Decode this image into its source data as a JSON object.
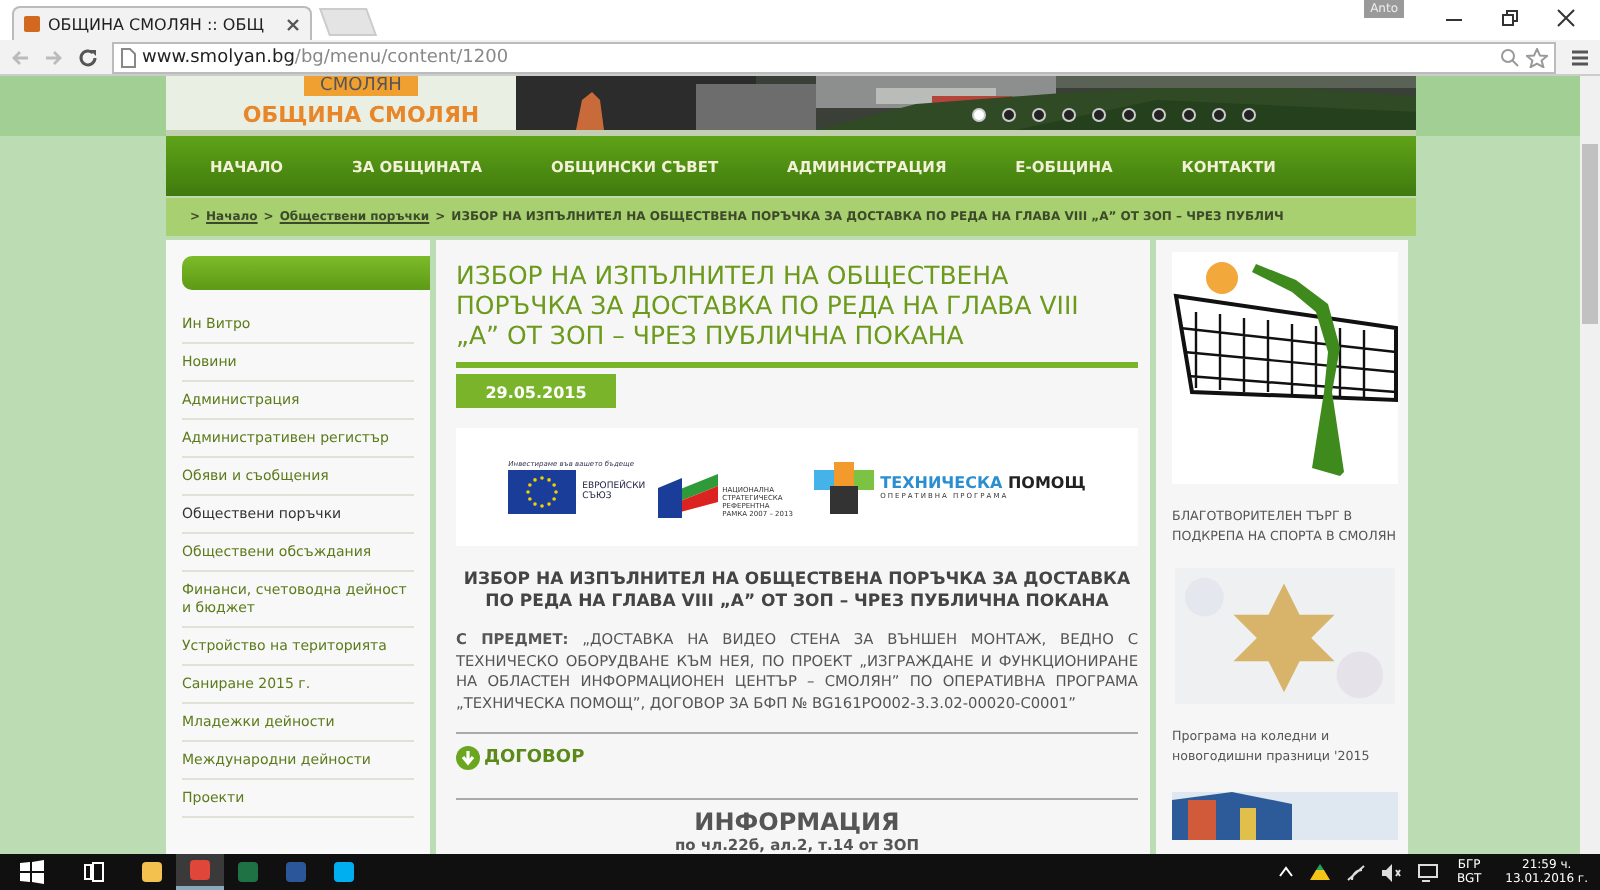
{
  "browser": {
    "tab_title": "ОБЩИНА СМОЛЯН :: ОБЩ",
    "user": "Anto",
    "url_host": "www.smolyan.bg",
    "url_path": "/bg/menu/content/1200"
  },
  "header": {
    "logo_badge": "СМОЛЯН",
    "logo_title": "ОБЩИНА СМОЛЯН",
    "slides": [
      {
        "selected": true
      },
      {
        "selected": false
      },
      {
        "selected": false
      },
      {
        "selected": false
      },
      {
        "selected": false
      },
      {
        "selected": false
      },
      {
        "selected": false
      },
      {
        "selected": false
      },
      {
        "selected": false
      },
      {
        "selected": false
      }
    ]
  },
  "nav": [
    "НАЧАЛО",
    "ЗА ОБЩИНАТА",
    "ОБЩИНСКИ СЪВЕТ",
    "АДМИНИСТРАЦИЯ",
    "Е-ОБЩИНА",
    "КОНТАКТИ"
  ],
  "breadcrumb": {
    "separator": ">",
    "links": [
      "Начало",
      "Обществени поръчки"
    ],
    "current": "ИЗБОР НА ИЗПЪЛНИТЕЛ НА ОБЩЕСТВЕНА ПОРЪЧКА ЗА ДОСТАВКА ПО РЕДА НА ГЛАВА VIII „А” ОТ ЗОП – ЧРЕЗ ПУБЛИЧ"
  },
  "sidebar": {
    "items": [
      {
        "label": "Ин Витро",
        "selected": false
      },
      {
        "label": "Новини",
        "selected": false
      },
      {
        "label": "Администрация",
        "selected": false
      },
      {
        "label": "Административен регистър",
        "selected": false
      },
      {
        "label": "Обяви и съобщения",
        "selected": false
      },
      {
        "label": "Обществени поръчки",
        "selected": true
      },
      {
        "label": "Обществени обсъждания",
        "selected": false
      },
      {
        "label": "Финанси, счетоводна дейност и бюджет",
        "selected": false
      },
      {
        "label": "Устройство на територията",
        "selected": false
      },
      {
        "label": "Саниране 2015 г.",
        "selected": false
      },
      {
        "label": "Младежки дейности",
        "selected": false
      },
      {
        "label": "Международни дейности",
        "selected": false
      },
      {
        "label": "Проекти",
        "selected": false
      }
    ]
  },
  "article": {
    "title": "ИЗБОР НА ИЗПЪЛНИТЕЛ НА ОБЩЕСТВЕНА ПОРЪЧКА ЗА ДОСТАВКА ПО РЕДА НА ГЛАВА VIII „А” ОТ ЗОП – ЧРЕЗ ПУБЛИЧНА ПОКАНА",
    "date": "29.05.2015",
    "logos": {
      "eu_caption": "Инвестираме във вашето бъдеще",
      "eu_name": "ЕВРОПЕЙСКИ СЪЮЗ",
      "nsrf": "НАЦИОНАЛНА СТРАТЕГИЧЕСКА РЕФЕРЕНТНА РАМКА 2007 – 2013",
      "ta_name_1": "ТЕХНИЧЕСКА",
      "ta_name_2": "ПОМОЩ",
      "ta_sub": "ОПЕРАТИВНА ПРОГРАМА"
    },
    "heading": "ИЗБОР НА ИЗПЪЛНИТЕЛ НА ОБЩЕСТВЕНА ПОРЪЧКА ЗА ДОСТАВКА ПО РЕДА НА ГЛАВА VIII „А” ОТ ЗОП – ЧРЕЗ ПУБЛИЧНА ПОКАНА",
    "subject": "**С ПРЕДМЕТ:** „ДОСТАВКА НА ВИДЕО СТЕНА ЗА ВЪНШЕН МОНТАЖ, ВЕДНО С ТЕХНИЧЕСКО ОБОРУДВАНЕ КЪМ НЕЯ, ПО ПРОЕКТ „ИЗГРАЖДАНЕ И ФУНКЦИОНИРАНЕ НА ОБЛАСТЕН ИНФОРМАЦИОНЕН ЦЕНТЪР – СМОЛЯН” ПО ОПЕРАТИВНА ПРОГРАМА „ТЕХНИЧЕСКА ПОМОЩ”, ДОГОВОР ЗА БФП № BG161PO002-3.3.02-00020-C0001”",
    "download": "ДОГОВОР",
    "info_title": "ИНФОРМАЦИЯ",
    "info_sub": "по чл.22б, ал.2, т.14 от ЗОП"
  },
  "news": [
    {
      "title": "БЛАГОТВОРИТЕЛЕН ТЪРГ В ПОДКРЕПА НА СПОРТА В СМОЛЯН",
      "kind": "volleyball"
    },
    {
      "title": "Програма на коледни и новогодишни празници '2015",
      "kind": "star"
    },
    {
      "kind": "building"
    }
  ],
  "taskbar": {
    "apps": [
      {
        "kind": "explorer",
        "selected": false
      },
      {
        "kind": "chrome",
        "selected": true
      },
      {
        "kind": "excel",
        "selected": false
      },
      {
        "kind": "word",
        "selected": false
      },
      {
        "kind": "skype",
        "selected": false
      }
    ],
    "lang_1": "БГР",
    "lang_2": "BGT",
    "time": "21:59 ч.",
    "date": "13.01.2016 г."
  }
}
